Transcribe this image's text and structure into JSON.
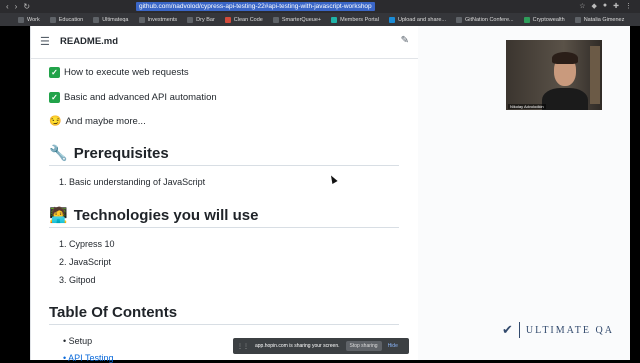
{
  "browser": {
    "url": "github.com/nadvolod/cypress-api-testing-22#api-testing-with-javascript-workshop",
    "bookmarks": [
      "Work",
      "Education",
      "Ultimateqa",
      "Investments",
      "Dry Bar",
      "Clean Code",
      "SmarterQueue+",
      "Members Portal",
      "Upload and share...",
      "GitNation Confere...",
      "Cryptowealth",
      "Natalia Gimenez"
    ]
  },
  "readme": {
    "title": "README.md",
    "items": [
      {
        "icon": "check-icon",
        "text": "How to execute web requests"
      },
      {
        "icon": "check-icon",
        "text": "Basic and advanced API automation"
      },
      {
        "icon": "smirk-emoji-icon",
        "text": "And maybe more..."
      }
    ],
    "prereq_heading": "Prerequisites",
    "prereq_icon": "🔧",
    "prereq_list": [
      "1. Basic understanding of JavaScript"
    ],
    "tech_heading": "Technologies you will use",
    "tech_icon": "🧑‍💻",
    "tech_list": [
      "1. Cypress 10",
      "2. JavaScript",
      "3. Gitpod"
    ],
    "toc_heading": "Table Of Contents",
    "toc_list": [
      "Setup",
      "API Testing"
    ]
  },
  "webcam": {
    "name_label": "Nikolay Advolodkin"
  },
  "logo": {
    "text": "ULTIMATE QA"
  },
  "sharing": {
    "message": "app.hopin.com is sharing your screen.",
    "stop_label": "Stop sharing",
    "hide_label": "Hide"
  }
}
